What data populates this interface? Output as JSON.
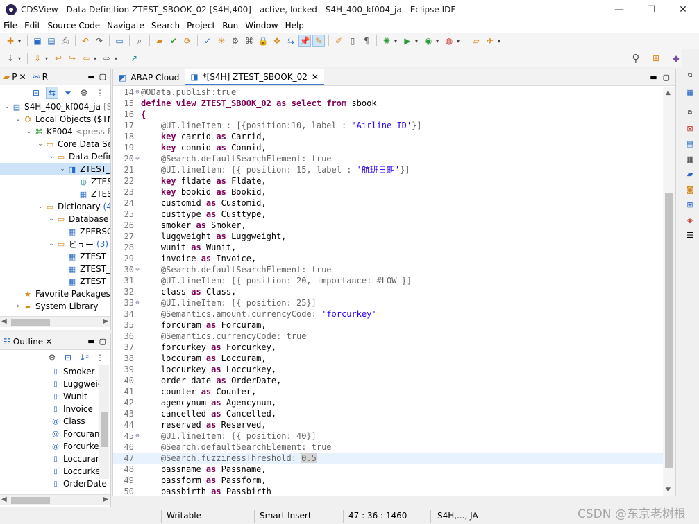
{
  "window": {
    "title": "CDSView - Data Definition ZTEST_SBOOK_02 [S4H,400] - active, locked - S4H_400_kf004_ja - Eclipse IDE",
    "minimize": "—",
    "maximize": "☐",
    "close": "✕"
  },
  "menu": [
    "File",
    "Edit",
    "Source Code",
    "Navigate",
    "Search",
    "Project",
    "Run",
    "Window",
    "Help"
  ],
  "project_explorer": {
    "tabs": [
      {
        "label": "P"
      },
      {
        "label": "R"
      }
    ],
    "tree": [
      {
        "indent": 0,
        "arrow": "⌄",
        "icon": "project",
        "label": "S4H_400_kf004_ja",
        "suffix": "[S4H,",
        "selected": false
      },
      {
        "indent": 1,
        "arrow": "⌄",
        "icon": "local",
        "label": "Local Objects ($TMP",
        "suffix": "",
        "selected": false
      },
      {
        "indent": 2,
        "arrow": "⌄",
        "icon": "package",
        "label": "KF004",
        "suffix": "<press F5",
        "selected": false
      },
      {
        "indent": 3,
        "arrow": "⌄",
        "icon": "folder",
        "label": "Core Data Serv",
        "suffix": "",
        "selected": false
      },
      {
        "indent": 4,
        "arrow": "⌄",
        "icon": "folder",
        "label": "Data Defini",
        "suffix": "",
        "selected": false
      },
      {
        "indent": 5,
        "arrow": "⌄",
        "icon": "ddl",
        "label": "ZTEST_S",
        "suffix": "",
        "selected": true
      },
      {
        "indent": 6,
        "arrow": "",
        "icon": "entity",
        "label": "ZTES",
        "suffix": "",
        "selected": false
      },
      {
        "indent": 6,
        "arrow": "",
        "icon": "table",
        "label": "ZTES",
        "suffix": "",
        "selected": false
      },
      {
        "indent": 3,
        "arrow": "⌄",
        "icon": "folder",
        "label": "Dictionary",
        "suffix": "(4)",
        "selected": false
      },
      {
        "indent": 4,
        "arrow": "⌄",
        "icon": "folder",
        "label": "Database T",
        "suffix": "",
        "selected": false
      },
      {
        "indent": 5,
        "arrow": "",
        "icon": "table",
        "label": "ZPERSO",
        "suffix": "",
        "selected": false
      },
      {
        "indent": 4,
        "arrow": "⌄",
        "icon": "folder",
        "label": "ビュー",
        "suffix": "(3)",
        "selected": false
      },
      {
        "indent": 5,
        "arrow": "",
        "icon": "table",
        "label": "ZTEST_C",
        "suffix": "",
        "selected": false
      },
      {
        "indent": 5,
        "arrow": "",
        "icon": "table",
        "label": "ZTEST_S",
        "suffix": "",
        "selected": false
      },
      {
        "indent": 5,
        "arrow": "",
        "icon": "table",
        "label": "ZTEST_S",
        "suffix": "",
        "selected": false
      },
      {
        "indent": 1,
        "arrow": "",
        "icon": "favorite",
        "label": "Favorite Packages",
        "suffix": "(0",
        "selected": false
      },
      {
        "indent": 1,
        "arrow": "›",
        "icon": "library",
        "label": "System Library",
        "suffix": "",
        "selected": false
      }
    ]
  },
  "outline": {
    "title": "Outline",
    "items": [
      {
        "icon": "field",
        "label": "Smoker"
      },
      {
        "icon": "field",
        "label": "Luggweigh"
      },
      {
        "icon": "field",
        "label": "Wunit"
      },
      {
        "icon": "field",
        "label": "Invoice"
      },
      {
        "icon": "annotated-field",
        "label": "Class"
      },
      {
        "icon": "annotated-field",
        "label": "Forcuram"
      },
      {
        "icon": "annotated-field",
        "label": "Forcurkey"
      },
      {
        "icon": "field",
        "label": "Loccuram"
      },
      {
        "icon": "field",
        "label": "Loccurkey"
      },
      {
        "icon": "field",
        "label": "OrderDate"
      }
    ]
  },
  "editor": {
    "tabs": [
      {
        "label": "ABAP Cloud",
        "active": false
      },
      {
        "label": "*[S4H] ZTEST_SBOOK_02",
        "active": true
      }
    ],
    "current_line": 47,
    "lines": [
      {
        "n": "14",
        "fold": "⊖",
        "tokens": [
          {
            "t": "@OData.publish:true",
            "c": "ann"
          }
        ]
      },
      {
        "n": "15",
        "fold": "",
        "tokens": [
          {
            "t": "define view ZTEST_SBOOK_02 ",
            "c": "kw"
          },
          {
            "t": "as select from ",
            "c": "kw"
          },
          {
            "t": "sbook",
            "c": ""
          }
        ]
      },
      {
        "n": "16",
        "fold": "",
        "tokens": [
          {
            "t": "{",
            "c": "kw"
          }
        ]
      },
      {
        "n": "17",
        "fold": "",
        "tokens": [
          {
            "t": "    @UI.lineItem : [{position:10, label : ",
            "c": "ann"
          },
          {
            "t": "'Airline ID'",
            "c": "str"
          },
          {
            "t": "}]",
            "c": "ann"
          }
        ]
      },
      {
        "n": "18",
        "fold": "",
        "tokens": [
          {
            "t": "    ",
            "c": ""
          },
          {
            "t": "key ",
            "c": "kw"
          },
          {
            "t": "carrid ",
            "c": ""
          },
          {
            "t": "as ",
            "c": "kw"
          },
          {
            "t": "Carrid,",
            "c": ""
          }
        ]
      },
      {
        "n": "19",
        "fold": "",
        "tokens": [
          {
            "t": "    ",
            "c": ""
          },
          {
            "t": "key ",
            "c": "kw"
          },
          {
            "t": "connid ",
            "c": ""
          },
          {
            "t": "as ",
            "c": "kw"
          },
          {
            "t": "Connid,",
            "c": ""
          }
        ]
      },
      {
        "n": "20",
        "fold": "⊖",
        "tokens": [
          {
            "t": "    @Search.defaultSearchElement: true",
            "c": "ann"
          }
        ]
      },
      {
        "n": "21",
        "fold": "",
        "tokens": [
          {
            "t": "    @UI.lineItem: [{ position: 15, label : ",
            "c": "ann"
          },
          {
            "t": "'航班日期'",
            "c": "str"
          },
          {
            "t": "}]",
            "c": "ann"
          }
        ]
      },
      {
        "n": "22",
        "fold": "",
        "tokens": [
          {
            "t": "    ",
            "c": ""
          },
          {
            "t": "key ",
            "c": "kw"
          },
          {
            "t": "fldate ",
            "c": ""
          },
          {
            "t": "as ",
            "c": "kw"
          },
          {
            "t": "Fldate,",
            "c": ""
          }
        ]
      },
      {
        "n": "23",
        "fold": "",
        "tokens": [
          {
            "t": "    ",
            "c": ""
          },
          {
            "t": "key ",
            "c": "kw"
          },
          {
            "t": "bookid ",
            "c": ""
          },
          {
            "t": "as ",
            "c": "kw"
          },
          {
            "t": "Bookid,",
            "c": ""
          }
        ]
      },
      {
        "n": "24",
        "fold": "",
        "tokens": [
          {
            "t": "    customid ",
            "c": ""
          },
          {
            "t": "as ",
            "c": "kw"
          },
          {
            "t": "Customid,",
            "c": ""
          }
        ]
      },
      {
        "n": "25",
        "fold": "",
        "tokens": [
          {
            "t": "    custtype ",
            "c": ""
          },
          {
            "t": "as ",
            "c": "kw"
          },
          {
            "t": "Custtype,",
            "c": ""
          }
        ]
      },
      {
        "n": "26",
        "fold": "",
        "tokens": [
          {
            "t": "    smoker ",
            "c": ""
          },
          {
            "t": "as ",
            "c": "kw"
          },
          {
            "t": "Smoker,",
            "c": ""
          }
        ]
      },
      {
        "n": "27",
        "fold": "",
        "tokens": [
          {
            "t": "    luggweight ",
            "c": ""
          },
          {
            "t": "as ",
            "c": "kw"
          },
          {
            "t": "Luggweight,",
            "c": ""
          }
        ]
      },
      {
        "n": "28",
        "fold": "",
        "tokens": [
          {
            "t": "    wunit ",
            "c": ""
          },
          {
            "t": "as ",
            "c": "kw"
          },
          {
            "t": "Wunit,",
            "c": ""
          }
        ]
      },
      {
        "n": "29",
        "fold": "",
        "tokens": [
          {
            "t": "    invoice ",
            "c": ""
          },
          {
            "t": "as ",
            "c": "kw"
          },
          {
            "t": "Invoice,",
            "c": ""
          }
        ]
      },
      {
        "n": "30",
        "fold": "⊖",
        "tokens": [
          {
            "t": "    @Search.defaultSearchElement: true",
            "c": "ann"
          }
        ]
      },
      {
        "n": "31",
        "fold": "",
        "tokens": [
          {
            "t": "    @UI.lineItem: [{ position: 20, importance: #LOW }]",
            "c": "ann"
          }
        ]
      },
      {
        "n": "32",
        "fold": "",
        "tokens": [
          {
            "t": "    class ",
            "c": ""
          },
          {
            "t": "as ",
            "c": "kw"
          },
          {
            "t": "Class,",
            "c": ""
          }
        ]
      },
      {
        "n": "33",
        "fold": "⊖",
        "tokens": [
          {
            "t": "    @UI.lineItem: [{ position: 25}]",
            "c": "ann"
          }
        ]
      },
      {
        "n": "34",
        "fold": "",
        "tokens": [
          {
            "t": "    @Semantics.amount.currencyCode: ",
            "c": "ann"
          },
          {
            "t": "'forcurkey'",
            "c": "str"
          }
        ]
      },
      {
        "n": "35",
        "fold": "",
        "tokens": [
          {
            "t": "    forcuram ",
            "c": ""
          },
          {
            "t": "as ",
            "c": "kw"
          },
          {
            "t": "Forcuram,",
            "c": ""
          }
        ]
      },
      {
        "n": "36",
        "fold": "",
        "tokens": [
          {
            "t": "    @Semantics.currencyCode: true",
            "c": "ann"
          }
        ]
      },
      {
        "n": "37",
        "fold": "",
        "tokens": [
          {
            "t": "    forcurkey ",
            "c": ""
          },
          {
            "t": "as ",
            "c": "kw"
          },
          {
            "t": "Forcurkey,",
            "c": ""
          }
        ]
      },
      {
        "n": "38",
        "fold": "",
        "tokens": [
          {
            "t": "    loccuram ",
            "c": ""
          },
          {
            "t": "as ",
            "c": "kw"
          },
          {
            "t": "Loccuram,",
            "c": ""
          }
        ]
      },
      {
        "n": "39",
        "fold": "",
        "tokens": [
          {
            "t": "    loccurkey ",
            "c": ""
          },
          {
            "t": "as ",
            "c": "kw"
          },
          {
            "t": "Loccurkey,",
            "c": ""
          }
        ]
      },
      {
        "n": "40",
        "fold": "",
        "tokens": [
          {
            "t": "    order_date ",
            "c": ""
          },
          {
            "t": "as ",
            "c": "kw"
          },
          {
            "t": "OrderDate,",
            "c": ""
          }
        ]
      },
      {
        "n": "41",
        "fold": "",
        "tokens": [
          {
            "t": "    counter ",
            "c": ""
          },
          {
            "t": "as ",
            "c": "kw"
          },
          {
            "t": "Counter,",
            "c": ""
          }
        ]
      },
      {
        "n": "42",
        "fold": "",
        "tokens": [
          {
            "t": "    agencynum ",
            "c": ""
          },
          {
            "t": "as ",
            "c": "kw"
          },
          {
            "t": "Agencynum,",
            "c": ""
          }
        ]
      },
      {
        "n": "43",
        "fold": "",
        "tokens": [
          {
            "t": "    cancelled ",
            "c": ""
          },
          {
            "t": "as ",
            "c": "kw"
          },
          {
            "t": "Cancelled,",
            "c": ""
          }
        ]
      },
      {
        "n": "44",
        "fold": "",
        "tokens": [
          {
            "t": "    reserved ",
            "c": ""
          },
          {
            "t": "as ",
            "c": "kw"
          },
          {
            "t": "Reserved,",
            "c": ""
          }
        ]
      },
      {
        "n": "45",
        "fold": "⊖",
        "tokens": [
          {
            "t": "    @UI.lineItem: [{ position: 40}]",
            "c": "ann"
          }
        ]
      },
      {
        "n": "46",
        "fold": "",
        "tokens": [
          {
            "t": "    @Search.defaultSearchElement: true",
            "c": "ann"
          }
        ]
      },
      {
        "n": "47",
        "fold": "",
        "tokens": [
          {
            "t": "    @Search.fuzzinessThreshold: ",
            "c": "ann"
          },
          {
            "t": "0.5",
            "c": "ann sel5"
          }
        ]
      },
      {
        "n": "48",
        "fold": "",
        "tokens": [
          {
            "t": "    passname ",
            "c": ""
          },
          {
            "t": "as ",
            "c": "kw"
          },
          {
            "t": "Passname,",
            "c": ""
          }
        ]
      },
      {
        "n": "49",
        "fold": "",
        "tokens": [
          {
            "t": "    passform ",
            "c": ""
          },
          {
            "t": "as ",
            "c": "kw"
          },
          {
            "t": "Passform,",
            "c": ""
          }
        ]
      },
      {
        "n": "50",
        "fold": "",
        "tokens": [
          {
            "t": "    passbirth ",
            "c": ""
          },
          {
            "t": "as ",
            "c": "kw"
          },
          {
            "t": "Passbirth",
            "c": ""
          }
        ]
      }
    ]
  },
  "status": {
    "writable": "Writable",
    "insert_mode": "Smart Insert",
    "position": "47 : 36 : 1460",
    "system": "S4H,..., JA"
  },
  "watermark": "CSDN @东京老树根",
  "colors": {
    "keyword": "#7f0055",
    "annotation": "#646464",
    "string": "#2a00ff",
    "current_line": "#e8f2fe",
    "selection": "#cde3f7"
  }
}
